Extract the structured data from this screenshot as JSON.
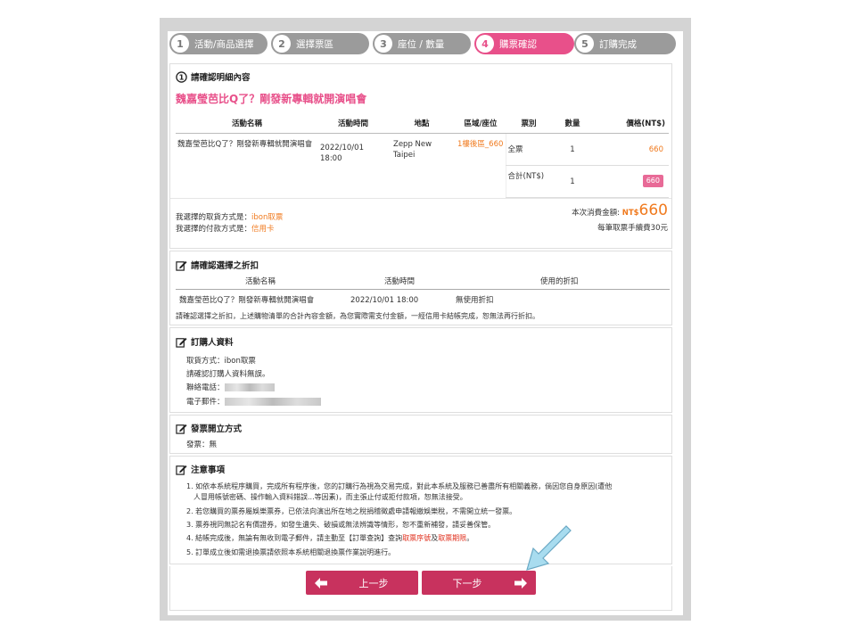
{
  "steps": [
    {
      "num": "1",
      "label": "活動/商品選擇",
      "state": "done"
    },
    {
      "num": "2",
      "label": "選擇票區",
      "state": "done"
    },
    {
      "num": "3",
      "label": "座位 / 數量",
      "state": "done"
    },
    {
      "num": "4",
      "label": "購票確認",
      "state": "active"
    },
    {
      "num": "5",
      "label": "訂購完成",
      "state": "todo"
    }
  ],
  "confirm": {
    "title": "請確認明細內容",
    "event_title": "魏嘉瑩芭比Q了？剛發新專輯就開演唱會",
    "headers": [
      "活動名稱",
      "活動時間",
      "地點",
      "區域/座位",
      "票別",
      "數量",
      "價格(NT$)"
    ],
    "event_name": "魏嘉瑩芭比Q了？剛發新專輯就開演唱會",
    "event_time": "2022/10/01 18:00",
    "venue": "Zepp New Taipei",
    "seat": "1樓後區_660",
    "ticket_type": "全票",
    "qty": "1",
    "price": "660",
    "subtotal_label": "合計(NT$)",
    "subtotal_qty": "1",
    "subtotal_price": "660",
    "pickup_label": "我選擇的取貨方式是：",
    "pickup_value": "ibon取票",
    "payment_label": "我選擇的付款方式是：",
    "payment_value": "信用卡",
    "total_label": "本次消費金額:",
    "total_currency": "NT$",
    "total_value": "660",
    "fee_note": "每筆取票手續費30元"
  },
  "discount": {
    "title": "請確認選擇之折扣",
    "headers": [
      "活動名稱",
      "活動時間",
      "使用的折扣"
    ],
    "event_name": "魏嘉瑩芭比Q了？剛發新專輯就開演唱會",
    "event_time": "2022/10/01 18:00",
    "discount": "無使用折扣",
    "warning": "請確認選擇之折扣，上述購物清單的合計內容金額，為您實際需支付金額，一經信用卡結帳完成，恕無法再行折扣。"
  },
  "buyer": {
    "title": "訂購人資料",
    "pickup": "取貨方式：ibon取票",
    "check_note": "請確認訂購人資料無誤。",
    "phone_label": "聯絡電話：",
    "email_label": "電子郵件："
  },
  "invoice": {
    "title": "發票開立方式",
    "value": "發票：無"
  },
  "notes": {
    "title": "注意事項",
    "items": [
      "1. 如依本系統程序購買，完成所有程序後，您的訂購行為視為交易完成，對此本系統及服務已善盡所有相關義務，倘因您自身原因(遭他",
      "人冒用帳號密碼、操作輸入資料錯誤...等因素)，而主張止付或拒付款項，恕無法接受。",
      "2. 若您購買的票券屬娛樂票券，已依法向演出所在地之稅捐稽徵處申請報繳娛樂稅，不需開立統一發票。",
      "3. 票券視同無記名有價證券，如發生遺失、破損或無法辨識等情形，恕不重新補發，請妥善保管。",
      "4. 結帳完成後，無論有無收到電子郵件，請主動至【訂單查詢】查詢",
      "5. 訂單成立後如需退換票請依照本系統相關退換票作業說明進行。"
    ],
    "item4_link1": "取票序號",
    "item4_and": "及",
    "item4_link2": "取票期限",
    "item4_end": "。"
  },
  "buttons": {
    "prev": "上一步",
    "next": "下一步"
  }
}
